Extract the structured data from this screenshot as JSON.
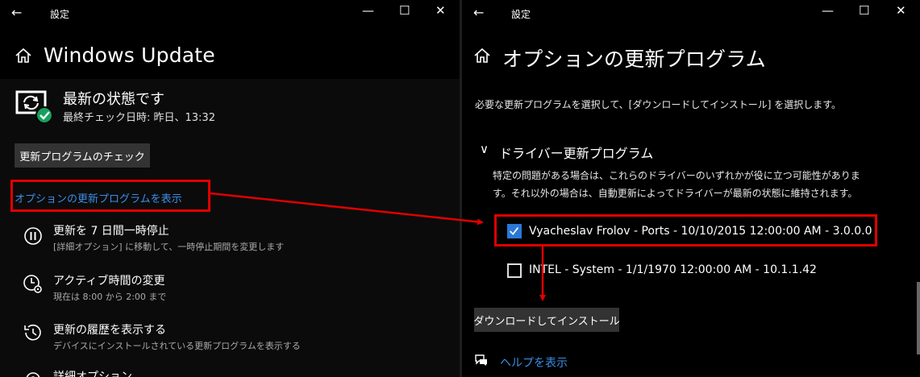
{
  "left_window": {
    "title": "設定",
    "back_glyph": "←",
    "controls": {
      "minimize": "—",
      "maximize": "☐",
      "close": "✕"
    },
    "page_title": "Windows Update",
    "status": {
      "title": "最新の状態です",
      "last_check": "最終チェック日時: 昨日、13:32"
    },
    "check_button": "更新プログラムのチェック",
    "optional_updates_link": "オプションの更新プログラムを表示",
    "items": [
      {
        "title": "更新を 7 日間一時停止",
        "subtitle": "[詳細オプション] に移動して、一時停止期間を変更します",
        "icon": "pause-icon"
      },
      {
        "title": "アクティブ時間の変更",
        "subtitle": "現在は 8:00 から 2:00 まで",
        "icon": "clock-gear-icon"
      },
      {
        "title": "更新の履歴を表示する",
        "subtitle": "デバイスにインストールされている更新プログラムを表示する",
        "icon": "history-icon"
      },
      {
        "title": "詳細オプション",
        "subtitle": "",
        "icon": "gear-icon"
      }
    ]
  },
  "right_window": {
    "title": "設定",
    "back_glyph": "←",
    "controls": {
      "minimize": "—",
      "maximize": "☐",
      "close": "✕"
    },
    "page_title": "オプションの更新プログラム",
    "instruction": "必要な更新プログラムを選択して、[ダウンロードしてインストール] を選択します。",
    "section": {
      "chevron": "∨",
      "title": "ドライバー更新プログラム",
      "description_line1": "特定の問題がある場合は、これらのドライバーのいずれかが役に立つ可能性がありま",
      "description_line2": "す。それ以外の場合は、自動更新によってドライバーが最新の状態に維持されます。"
    },
    "drivers": [
      {
        "label": "Vyacheslav Frolov - Ports - 10/10/2015 12:00:00 AM - 3.0.0.0",
        "checked": true
      },
      {
        "label": "INTEL - System - 1/1/1970 12:00:00 AM - 10.1.1.42",
        "checked": false
      }
    ],
    "install_button": "ダウンロードしてインストール",
    "help_link": "ヘルプを表示"
  },
  "colors": {
    "background": "#000000",
    "link": "#3c8ee6",
    "button": "#333333",
    "checkbox_accent": "#2a78d6",
    "annotation_red": "#e00000",
    "status_ok_green": "#16a05d"
  }
}
